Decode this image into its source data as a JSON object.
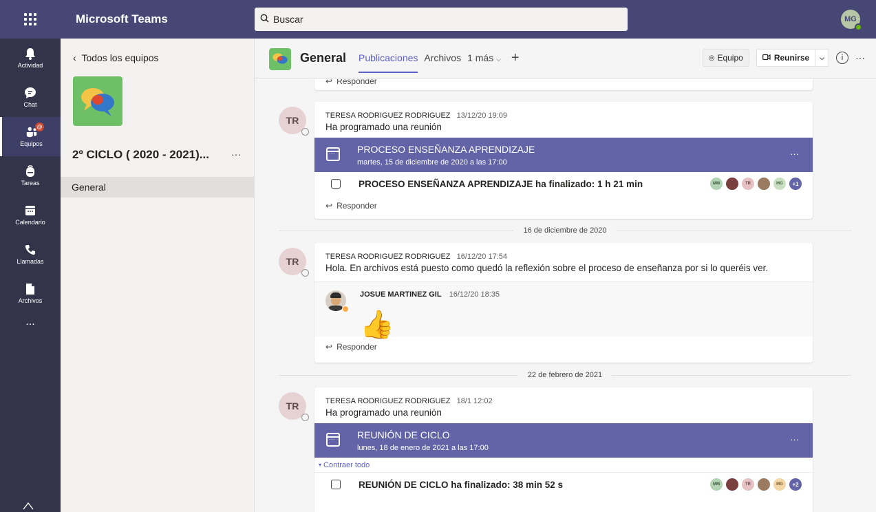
{
  "app": {
    "title": "Microsoft Teams"
  },
  "search": {
    "placeholder": "Buscar"
  },
  "user": {
    "initials": "MG"
  },
  "rail": [
    {
      "label": "Actividad"
    },
    {
      "label": "Chat"
    },
    {
      "label": "Equipos",
      "badge": "@"
    },
    {
      "label": "Tareas"
    },
    {
      "label": "Calendario"
    },
    {
      "label": "Llamadas"
    },
    {
      "label": "Archivos"
    }
  ],
  "rail_more": "...",
  "team": {
    "back_label": "Todos los equipos",
    "name": "2º CICLO ( 2020 - 2021)...",
    "more": "···",
    "channel": "General"
  },
  "header": {
    "channel_title": "General",
    "tabs": [
      "Publicaciones",
      "Archivos",
      "1 más"
    ],
    "team_button": "Equipo",
    "meet_button": "Reunirse",
    "more": "···"
  },
  "reply_label": "Responder",
  "posts": [
    {
      "initials": "TR",
      "author": "TERESA RODRIGUEZ RODRIGUEZ",
      "time": "13/12/20 19:09",
      "text": "Ha programado una reunión",
      "meeting": {
        "title": "PROCESO ENSEÑANZA APRENDIZAJE",
        "date": "martes, 15 de diciembre de 2020 a las 17:00",
        "ended": "PROCESO ENSEÑANZA APRENDIZAJE ha finalizado: 1 h 21 min",
        "attendees": [
          "MM",
          "TR",
          "MG",
          "+1"
        ]
      }
    },
    {
      "initials": "TR",
      "author": "TERESA RODRIGUEZ RODRIGUEZ",
      "time": "16/12/20 17:54",
      "text": "Hola. En archivos está puesto como quedó la reflexión sobre el proceso de enseñanza por si lo queréis ver.",
      "reply": {
        "author": "JOSUE MARTINEZ GIL",
        "time": "16/12/20 18:35",
        "emoji": "👍"
      }
    },
    {
      "initials": "TR",
      "author": "TERESA RODRIGUEZ RODRIGUEZ",
      "time": "18/1 12:02",
      "text": "Ha programado una reunión",
      "meeting": {
        "title": "REUNIÓN DE CICLO",
        "date": "lunes, 18 de enero de 2021 a las 17:00",
        "collapse": "Contraer todo",
        "ended": "REUNIÓN DE CICLO ha finalizado: 38 min 52 s",
        "attendees": [
          "MM",
          "TR",
          "MG",
          "+2"
        ]
      }
    }
  ],
  "date_separators": [
    "16 de diciembre de 2020",
    "22 de febrero de 2021"
  ],
  "colors": {
    "brand": "#464775",
    "accent": "#6264a7",
    "rail": "#33344a"
  }
}
